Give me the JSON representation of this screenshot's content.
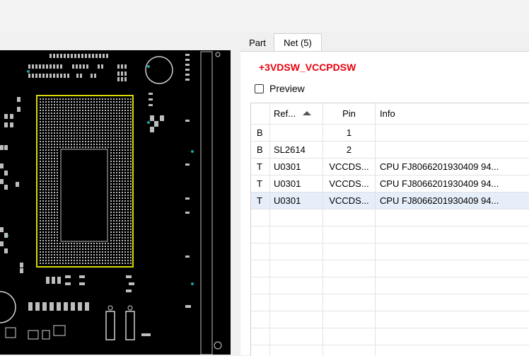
{
  "panel": {
    "tabs": [
      {
        "label": "Part"
      },
      {
        "label": "Net (5)"
      }
    ],
    "net_name": "+3VDSW_VCCPDSW",
    "preview_label": "Preview",
    "preview_checked": false
  },
  "table": {
    "columns": [
      "",
      "Ref...",
      "Pin",
      "Info"
    ],
    "sort_column": "Ref...",
    "rows": [
      {
        "side": "B",
        "ref": "",
        "pin": "1",
        "info": ""
      },
      {
        "side": "B",
        "ref": "SL2614",
        "pin": "2",
        "info": ""
      },
      {
        "side": "T",
        "ref": "U0301",
        "pin": "VCCDS...",
        "info": "CPU FJ8066201930409 94..."
      },
      {
        "side": "T",
        "ref": "U0301",
        "pin": "VCCDS...",
        "info": "CPU FJ8066201930409 94..."
      },
      {
        "side": "T",
        "ref": "U0301",
        "pin": "VCCDS...",
        "info": "CPU FJ8066201930409 94..."
      }
    ],
    "selected_row": 4
  },
  "colors": {
    "net_name": "#e8000b",
    "board_background": "#000000",
    "cpu_outline": "#d7d70a",
    "pads": "#cfcfcf",
    "vias": "#1aa3a3",
    "selected_row": "#e6eefa"
  }
}
